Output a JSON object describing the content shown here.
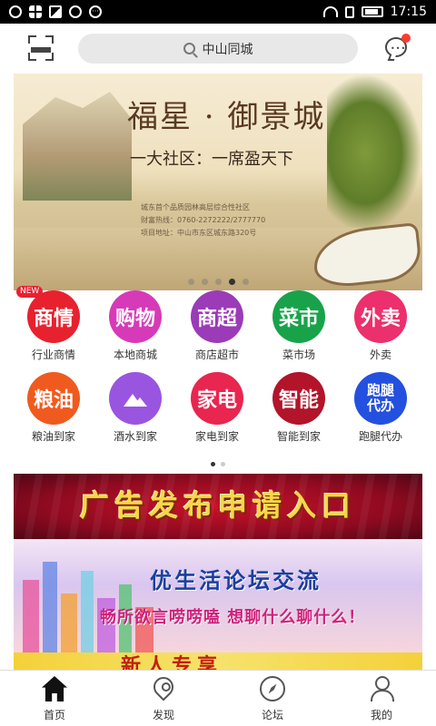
{
  "status_bar": {
    "time": "17:15"
  },
  "header": {
    "search_text": "中山同城"
  },
  "banner": {
    "title": "福星 · 御景城",
    "subtitle": "一大社区：一席盈天下",
    "line1": "城东首个品质园林高层综合性社区",
    "line2": "财富热线：0760-2272222/2777770",
    "line3": "项目地址：中山市东区城东路320号"
  },
  "categories": [
    {
      "icon_text": "商情",
      "label": "行业商情",
      "color": "#e8212f",
      "badge": "NEW"
    },
    {
      "icon_text": "购物",
      "label": "本地商城",
      "color": "#d63ab8"
    },
    {
      "icon_text": "商超",
      "label": "商店超市",
      "color": "#9b3bb8"
    },
    {
      "icon_text": "菜市",
      "label": "菜市场",
      "color": "#18a34a"
    },
    {
      "icon_text": "外卖",
      "label": "外卖",
      "color": "#ec2f6d"
    },
    {
      "icon_text": "粮油",
      "label": "粮油到家",
      "color": "#f05a1f"
    },
    {
      "icon_text": "",
      "label": "酒水到家",
      "color": "#9a55e0",
      "icon": "image-icon"
    },
    {
      "icon_text": "家电",
      "label": "家电到家",
      "color": "#e8264f"
    },
    {
      "icon_text": "智能",
      "label": "智能到家",
      "color": "#b2142a"
    },
    {
      "icon_text": "跑腿代办",
      "label": "跑腿代办",
      "color": "#2450e0"
    }
  ],
  "ads": {
    "ad1_text": "广告发布申请入口",
    "ad2_title": "优生活论坛交流",
    "ad2_sub": "畅所欲言唠唠嗑 想聊什么聊什么！",
    "ad3_text": "新人专享"
  },
  "bottom_nav": [
    {
      "label": "首页",
      "icon": "home-icon"
    },
    {
      "label": "发现",
      "icon": "location-pin-icon"
    },
    {
      "label": "论坛",
      "icon": "compass-icon"
    },
    {
      "label": "我的",
      "icon": "user-icon"
    }
  ]
}
